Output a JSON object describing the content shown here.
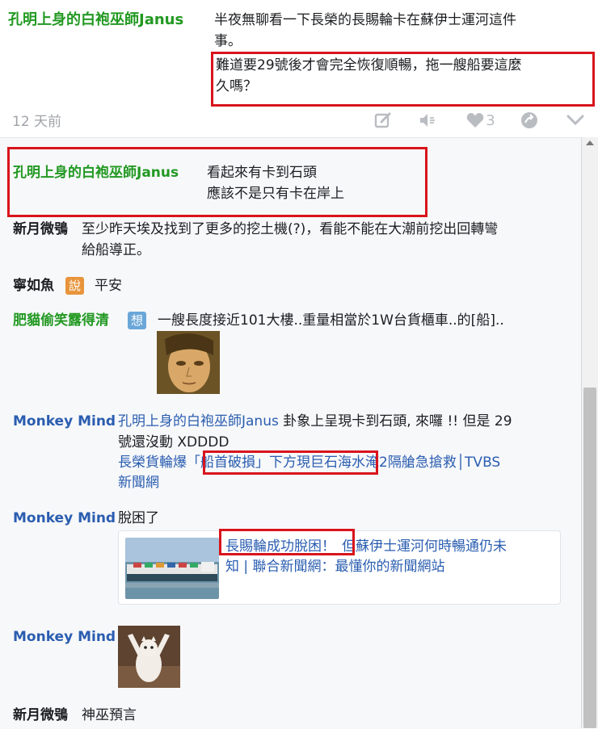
{
  "post": {
    "author": "孔明上身的白袍巫師Janus",
    "line1": "半夜無聊看一下長榮的長賜輪卡在蘇伊士運河這件",
    "line2": "事。",
    "line3": "難道要29號後才會完全恢復順暢，拖一艘船要這麼",
    "line4": "久嗎？",
    "time": "12 天前",
    "likes": "3"
  },
  "comments": [
    {
      "author": "孔明上身的白袍巫師Janus",
      "lines": [
        "看起來有卡到石頭",
        "應該不是只有卡在岸上"
      ]
    },
    {
      "author": "新月微鴞",
      "lines": [
        "至少昨天埃及找到了更多的挖土機(?)，看能不能在大潮前挖出回轉彎",
        "給船導正。"
      ]
    },
    {
      "author": "寧如魚",
      "tag": "說",
      "text": "平安"
    },
    {
      "author": "肥貓偷笑露得清",
      "tag": "想",
      "text": "一艘長度接近101大樓..重量相當於1W台貨櫃車..的[船].."
    },
    {
      "author": "Monkey Mind",
      "mention": "孔明上身的白袍巫師Janus",
      "text_a": " 卦象上呈現卡到石頭, 來囉 !! 但是 29",
      "text_b": "號還沒動 XDDDD",
      "link_a": "長榮貨輪爆",
      "link_b": "「船首破損」下方現巨石",
      "link_c": "海水淹2隔艙急搶救│TVBS",
      "link_d": "新聞網"
    },
    {
      "author": "Monkey Mind",
      "text": "脫困了",
      "card_title_a": "長賜輪成功脫困！",
      "card_title_b": "但蘇伊士運河何時暢通仍未",
      "card_title_c": "知 | 聯合新聞網：最懂你的新聞網站"
    },
    {
      "author": "Monkey Mind"
    },
    {
      "author": "新月微鴞",
      "text": "神巫預言"
    }
  ],
  "icons": [
    "edit-icon",
    "volume-icon",
    "heart-icon",
    "share-icon",
    "chevron-down-icon"
  ],
  "colors": {
    "author_green": "#229922",
    "author_blue": "#2a5db0",
    "highlight_red": "#d8141c",
    "tag_orange": "#e8943a",
    "tag_blue": "#6aa7d8"
  }
}
